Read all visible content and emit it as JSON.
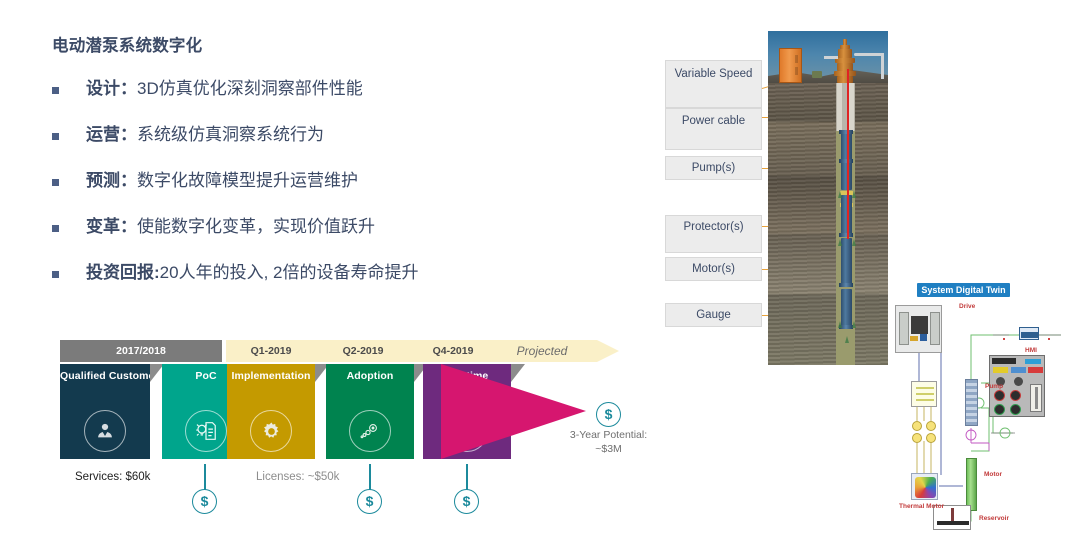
{
  "slide": {
    "headline": "电动潜泵系统数字化",
    "bullets": [
      {
        "label": "设计：",
        "body": "3D仿真优化深刻洞察部件性能"
      },
      {
        "label": "运营：",
        "body": "系统级仿真洞察系统行为"
      },
      {
        "label": "预测：",
        "body": "数字化故障模型提升运营维护"
      },
      {
        "label": "变革：",
        "body": "使能数字化变革，实现价值跃升"
      },
      {
        "label": "投资回报:",
        "body": "20人年的投入, 2倍的设备寿命提升"
      }
    ]
  },
  "timeline": {
    "bands": [
      {
        "label": "2017/2018",
        "style": "gray"
      },
      {
        "label": "Q1-2019",
        "style": "cream"
      },
      {
        "label": "Q2-2019",
        "style": "cream"
      },
      {
        "label": "Q4-2019",
        "style": "cream"
      },
      {
        "label": "Projected",
        "style": "cream-italic"
      }
    ],
    "stages": [
      {
        "title": "Qualified Customer",
        "color": "#133a4e",
        "icon": "customer-icon"
      },
      {
        "title": "PoC",
        "color": "#00a58c",
        "icon": "idea-document-icon"
      },
      {
        "title": "Implementation",
        "color": "#c49a00",
        "icon": "gear-icon"
      },
      {
        "title": "Adoption",
        "color": "#00834f",
        "icon": "adoption-orbit-icon"
      },
      {
        "title": "Runtime",
        "color": "#6e2a7e",
        "icon": "play-icon"
      }
    ],
    "money_symbol": "$",
    "costs": [
      {
        "text": "Services: $60k",
        "tone": "dark"
      },
      {
        "text": "Licenses: ~$50k",
        "tone": "gray"
      }
    ],
    "potential": {
      "line1": "3-Year Potential:",
      "line2": "~$3M"
    }
  },
  "well": {
    "callouts": [
      {
        "label": "Variable Speed"
      },
      {
        "label": "Power cable"
      },
      {
        "label": "Pump(s)"
      },
      {
        "label": "Protector(s)"
      },
      {
        "label": "Motor(s)"
      },
      {
        "label": "Gauge"
      }
    ]
  },
  "digital_twin": {
    "title": "System Digital Twin",
    "labels": [
      "Drive",
      "Pump",
      "HMI",
      "Motor",
      "Thermal Motor",
      "Reservoir"
    ]
  },
  "colors": {
    "text_navy": "#3c4a66",
    "teal": "#1c8a9c",
    "pink": "#d6166f",
    "band_gray": "#7b7b7b",
    "band_cream": "#faf0c8",
    "twin_blue": "#1f7fc2",
    "connector_orange": "#e8a33d"
  }
}
